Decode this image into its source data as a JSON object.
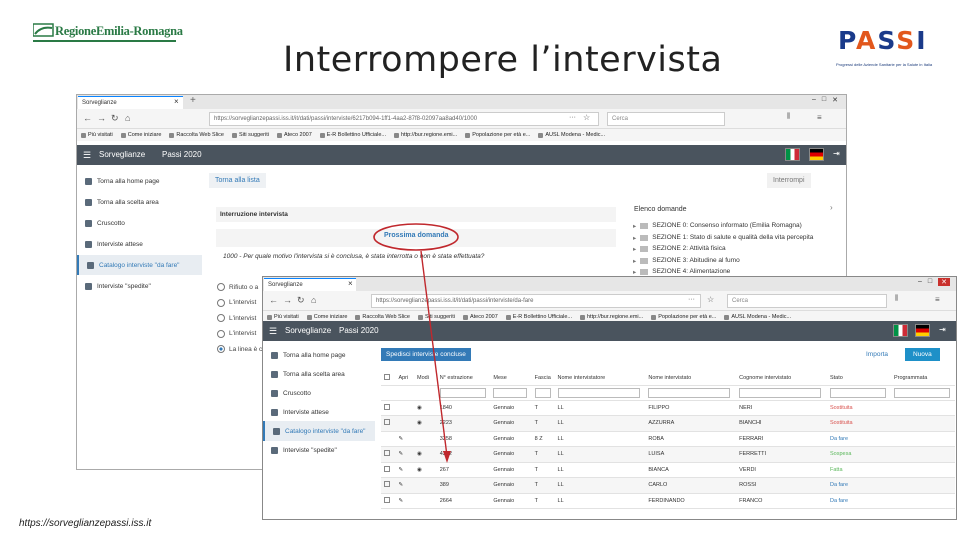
{
  "slide": {
    "title": "Interrompere l’intervista",
    "footer_url": "https://sorveglianzepassi.iss.it",
    "logo_left_text": "RegioneEmilia-Romagna",
    "logo_right_letters": [
      "P",
      "A",
      "S",
      "S",
      "I"
    ],
    "logo_right_letter_colors": [
      "#1a3a8a",
      "#e2571c",
      "#1a3a8a",
      "#e2571c",
      "#1a3a8a"
    ],
    "logo_right_subtitle": "Progressi delle Aziende Sanitarie per la Salute in Italia"
  },
  "back_window": {
    "tab_title": "Sorveglianze",
    "url": "https://sorveglianzepassi.iss.it/it/dati/passi/interviste/6217b094-1ff1-4aa2-87f8-02097aa8ad40/1000",
    "search_placeholder": "Cerca",
    "bookmarks": [
      "Più visitati",
      "Come iniziare",
      "Raccolta Web Slice",
      "Siti suggeriti",
      "Ateco 2007",
      "E-R Bollettino Ufficiale...",
      "http://bur.regione.emi...",
      "Popolazione per età e...",
      "AUSL Modena - Medic..."
    ],
    "app_name": "Sorveglianze",
    "app_section": "Passi 2020",
    "sidebar": [
      "Torna alla home page",
      "Torna alla scelta area",
      "Cruscotto",
      "Interviste attese",
      "Catalogo interviste \"da fare\"",
      "Interviste \"spedite\""
    ],
    "back_to_list": "Torna alla lista",
    "interrupt": "Interrompi",
    "panel_title": "Interruzione intervista",
    "next_question": "Prossima domanda",
    "question": "1000 - Per quale motivo l'intervista si è conclusa, è stata interrotta o non è stata effettuata?",
    "radio_options": [
      "Rifiuto o a",
      "L'intervist",
      "L'intervist",
      "L'intervist",
      "La linea è c"
    ],
    "list_title": "Elenco domande",
    "sections": [
      "SEZIONE 0: Consenso informato (Emilia Romagna)",
      "SEZIONE 1: Stato di salute e qualità della vita percepita",
      "SEZIONE 2: Attività fisica",
      "SEZIONE 3: Abitudine al fumo",
      "SEZIONE 4: Alimentazione"
    ]
  },
  "front_window": {
    "tab_title": "Sorveglianze",
    "url": "https://sorveglianzepassi.iss.it/it/dati/passi/interviste/da-fare",
    "search_placeholder": "Cerca",
    "bookmarks": [
      "Più visitati",
      "Come iniziare",
      "Raccolta Web Slice",
      "Siti suggeriti",
      "Ateco 2007",
      "E-R Bollettino Ufficiale...",
      "http://bur.regione.emi...",
      "Popolazione per età e...",
      "AUSL Modena - Medic..."
    ],
    "app_name": "Sorveglianze",
    "app_section": "Passi 2020",
    "sidebar": [
      "Torna alla home page",
      "Torna alla scelta area",
      "Cruscotto",
      "Interviste attese",
      "Catalogo interviste \"da fare\"",
      "Interviste \"spedite\""
    ],
    "btn_concluded": "Spedisci interviste concluse",
    "btn_import": "Importa",
    "btn_new": "Nuova",
    "columns": [
      "Apri",
      "Modi",
      "N° estrazione",
      "Mese",
      "Fascia",
      "Nome intervistatore",
      "Nome intervistato",
      "Cognome intervistato",
      "Stato",
      "Programmata"
    ],
    "rows": [
      {
        "num": "1840",
        "mese": "Gennaio",
        "fascia": "T",
        "intv": "LL",
        "nome": "FILIPPO",
        "cognome": "NERI",
        "stato": "Sostituita",
        "color": "#d9534f",
        "eye": true,
        "pencil": false
      },
      {
        "num": "2223",
        "mese": "Gennaio",
        "fascia": "T",
        "intv": "LL",
        "nome": "AZZURRA",
        "cognome": "BIANCHI",
        "stato": "Sostituita",
        "color": "#d9534f",
        "eye": true,
        "pencil": false
      },
      {
        "num": "3258",
        "mese": "Gennaio",
        "fascia": "8 Z",
        "intv": "LL",
        "nome": "ROBA",
        "cognome": "FERRARI",
        "stato": "Da fare",
        "color": "#337ab7",
        "eye": false,
        "pencil": true
      },
      {
        "num": "4342",
        "mese": "Gennaio",
        "fascia": "T",
        "intv": "LL",
        "nome": "LUISA",
        "cognome": "FERRETTI",
        "stato": "Sospesa",
        "color": "#5cb85c",
        "eye": true,
        "pencil": true
      },
      {
        "num": "267",
        "mese": "Gennaio",
        "fascia": "T",
        "intv": "LL",
        "nome": "BIANCA",
        "cognome": "VERDI",
        "stato": "Fatta",
        "color": "#5cb85c",
        "eye": true,
        "pencil": true
      },
      {
        "num": "389",
        "mese": "Gennaio",
        "fascia": "T",
        "intv": "LL",
        "nome": "CARLO",
        "cognome": "ROSSI",
        "stato": "Da fare",
        "color": "#337ab7",
        "eye": false,
        "pencil": true
      },
      {
        "num": "2664",
        "mese": "Gennaio",
        "fascia": "T",
        "intv": "LL",
        "nome": "FERDINANDO",
        "cognome": "FRANCO",
        "stato": "Da fare",
        "color": "#337ab7",
        "eye": false,
        "pencil": true
      }
    ]
  }
}
